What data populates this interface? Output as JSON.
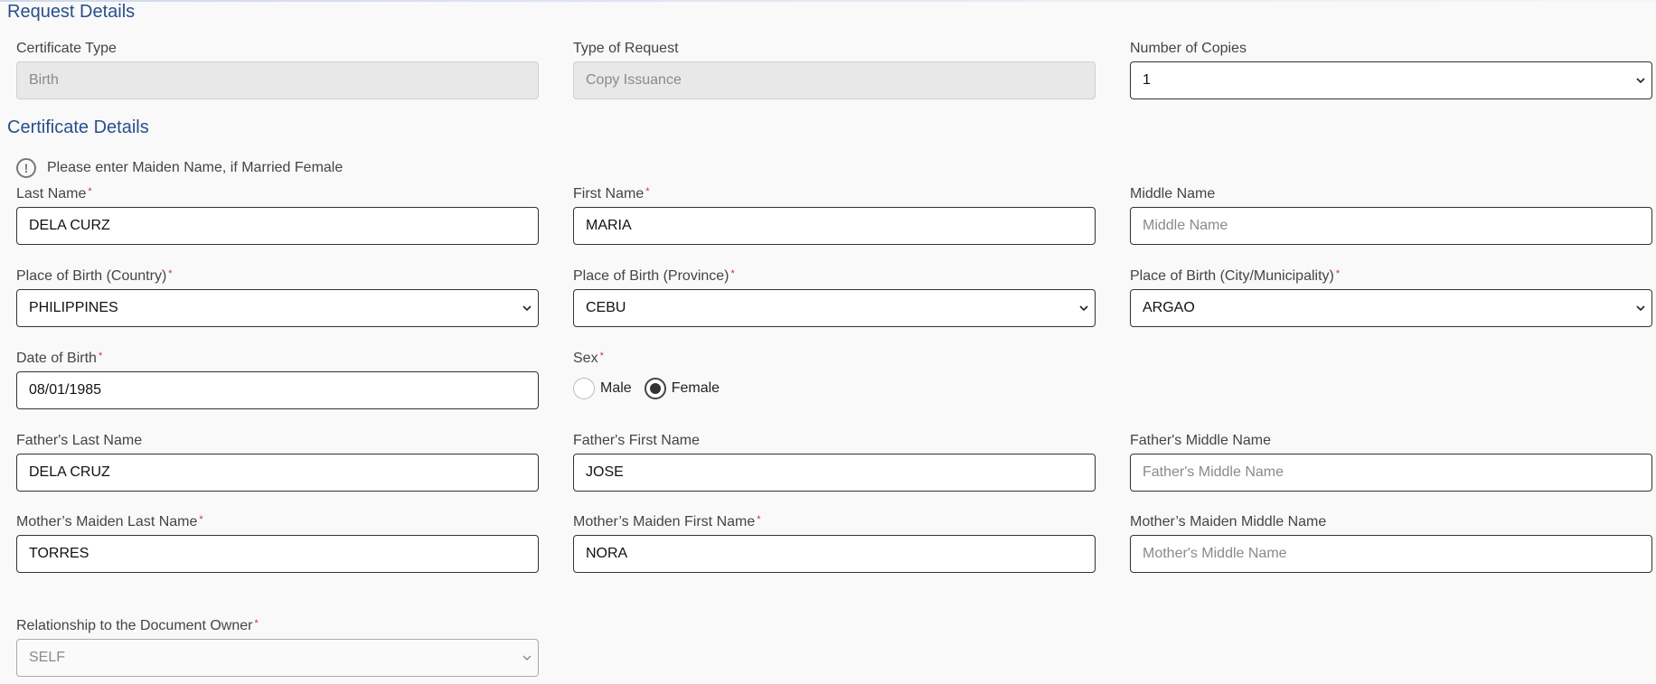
{
  "request_details": {
    "title": "Request Details",
    "certificate_type": {
      "label": "Certificate Type",
      "value": "Birth"
    },
    "type_of_request": {
      "label": "Type of Request",
      "value": "Copy Issuance"
    },
    "number_of_copies": {
      "label": "Number of Copies",
      "value": "1"
    }
  },
  "certificate_details": {
    "title": "Certificate Details",
    "notice": "Please enter Maiden Name, if Married Female",
    "last_name": {
      "label": "Last Name",
      "value": "DELA CURZ",
      "required": "*"
    },
    "first_name": {
      "label": "First Name",
      "value": "MARIA",
      "required": "*"
    },
    "middle_name": {
      "label": "Middle Name",
      "placeholder": "Middle Name"
    },
    "birth_country": {
      "label": "Place of Birth (Country)",
      "value": "PHILIPPINES",
      "required": "*"
    },
    "birth_province": {
      "label": "Place of Birth (Province)",
      "value": "CEBU",
      "required": "*"
    },
    "birth_city": {
      "label": "Place of Birth (City/Municipality)",
      "value": "ARGAO",
      "required": "*"
    },
    "date_of_birth": {
      "label": "Date of Birth",
      "value": "08/01/1985",
      "required": "*"
    },
    "sex": {
      "label": "Sex",
      "required": "*",
      "options": [
        "Male",
        "Female"
      ],
      "selected": "Female"
    },
    "father_last": {
      "label": "Father's Last Name",
      "value": "DELA CRUZ"
    },
    "father_first": {
      "label": "Father's First Name",
      "value": "JOSE"
    },
    "father_middle": {
      "label": "Father's Middle Name",
      "placeholder": "Father's Middle Name"
    },
    "mother_last": {
      "label": "Mother’s Maiden Last Name",
      "value": "TORRES",
      "required": "*"
    },
    "mother_first": {
      "label": "Mother’s Maiden First Name",
      "value": "NORA",
      "required": "*"
    },
    "mother_middle": {
      "label": "Mother’s Maiden Middle Name",
      "placeholder": "Mother's Middle Name"
    },
    "relationship": {
      "label": "Relationship to the Document Owner",
      "value": "SELF",
      "required": "*"
    }
  },
  "icons": {
    "notice": "exclamation-circle-icon",
    "dropdown": "chevron-down-icon"
  },
  "colors": {
    "section_title": "#2a4e8c",
    "required": "#d03030"
  }
}
